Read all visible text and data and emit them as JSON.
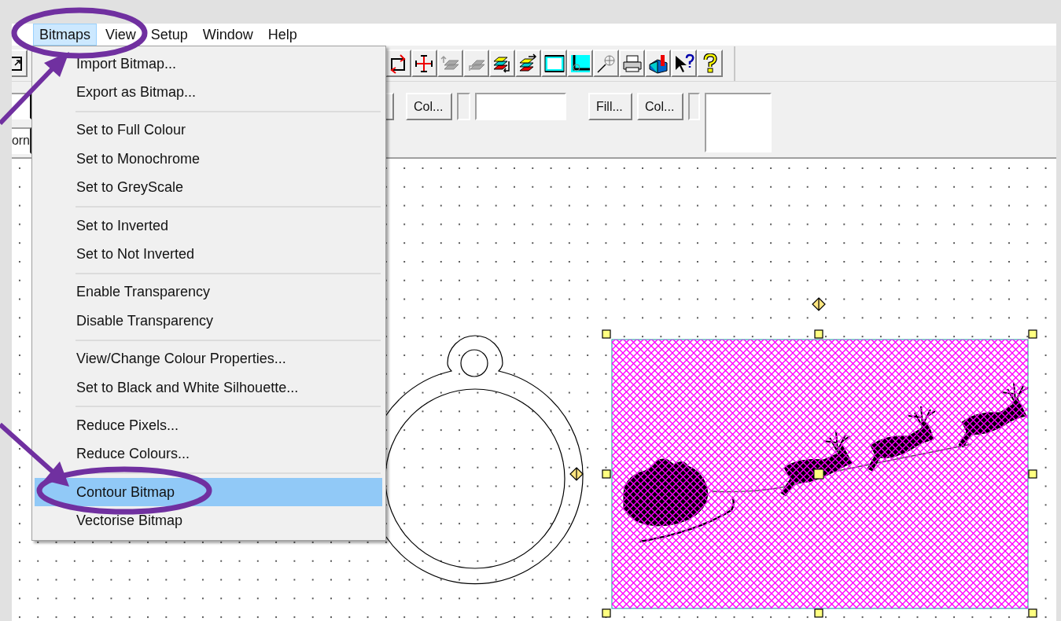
{
  "menu_bar": {
    "items": [
      {
        "label": "Bitmaps",
        "selected": true
      },
      {
        "label": "View",
        "selected": false
      },
      {
        "label": "Setup",
        "selected": false
      },
      {
        "label": "Window",
        "selected": false
      },
      {
        "label": "Help",
        "selected": false
      }
    ]
  },
  "toolbar_row_2": {
    "left_field_value": "orn",
    "buttons": [
      "Col...",
      "Fill...",
      "Col..."
    ]
  },
  "dropdown_menu": {
    "groups": [
      [
        {
          "label": "Import Bitmap...",
          "selected": false
        },
        {
          "label": "Export as Bitmap...",
          "selected": false
        }
      ],
      [
        {
          "label": "Set to Full Colour",
          "selected": false
        },
        {
          "label": "Set to Monochrome",
          "selected": false
        },
        {
          "label": "Set to GreyScale",
          "selected": false
        }
      ],
      [
        {
          "label": "Set to Inverted",
          "selected": false
        },
        {
          "label": "Set to Not Inverted",
          "selected": false
        }
      ],
      [
        {
          "label": "Enable Transparency",
          "selected": false
        },
        {
          "label": "Disable Transparency",
          "selected": false
        }
      ],
      [
        {
          "label": "View/Change Colour Properties...",
          "selected": false
        },
        {
          "label": "Set to Black and White Silhouette...",
          "selected": false
        }
      ],
      [
        {
          "label": "Reduce Pixels...",
          "selected": false
        },
        {
          "label": "Reduce Colours...",
          "selected": false
        }
      ],
      [
        {
          "label": "Contour Bitmap",
          "selected": true
        },
        {
          "label": "Vectorise Bitmap",
          "selected": false
        }
      ]
    ]
  }
}
